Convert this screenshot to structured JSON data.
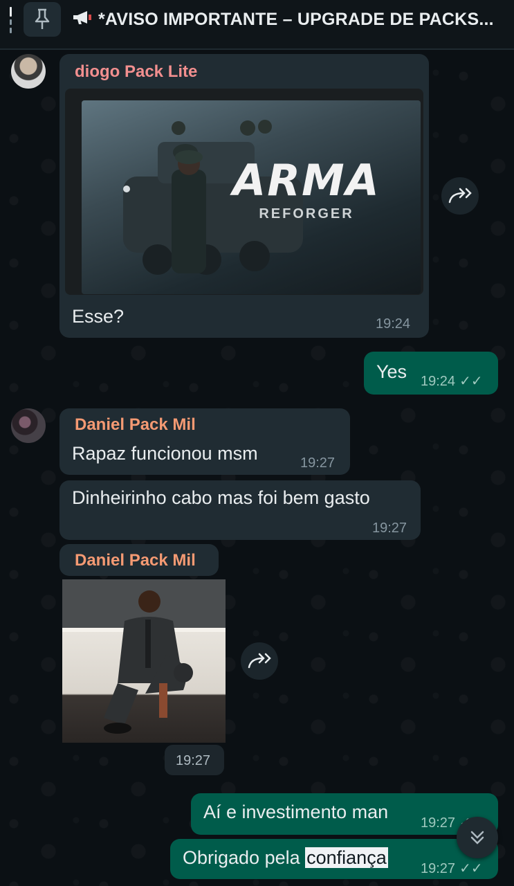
{
  "pinned": {
    "text": "*AVISO IMPORTANTE – UPGRADE DE PACKS..."
  },
  "messages": [
    {
      "sender": "diogo Pack Lite",
      "image_title": "ARMA",
      "image_subtitle": "REFORGER",
      "text": "Esse?",
      "time": "19:24"
    },
    {
      "text": "Yes",
      "time": "19:24"
    },
    {
      "sender": "Daniel Pack Mil",
      "text": "Rapaz funcionou msm",
      "time": "19:27"
    },
    {
      "text": "Dinheirinho cabo mas foi bem gasto",
      "time": "19:27"
    },
    {
      "sender": "Daniel Pack Mil",
      "time": "19:27"
    },
    {
      "text": "Aí e investimento man",
      "time": "19:27"
    },
    {
      "text_before": "Obrigado pela ",
      "text_highlight": "confiança",
      "time": "19:27"
    }
  ],
  "colors": {
    "incoming": "#202c33",
    "outgoing": "#005c4b",
    "sender_pink": "#f28f8f",
    "sender_orange": "#f59a73"
  }
}
